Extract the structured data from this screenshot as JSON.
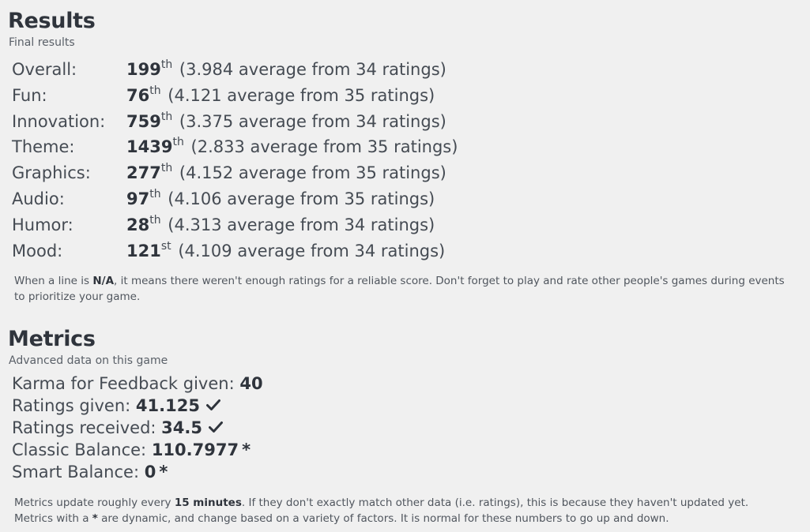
{
  "results": {
    "title": "Results",
    "subtitle": "Final results",
    "rows": [
      {
        "label": "Overall:",
        "rank": "199",
        "suffix": "th",
        "detail": "(3.984 average from 34 ratings)"
      },
      {
        "label": "Fun:",
        "rank": "76",
        "suffix": "th",
        "detail": "(4.121 average from 35 ratings)"
      },
      {
        "label": "Innovation:",
        "rank": "759",
        "suffix": "th",
        "detail": "(3.375 average from 34 ratings)"
      },
      {
        "label": "Theme:",
        "rank": "1439",
        "suffix": "th",
        "detail": "(2.833 average from 35 ratings)"
      },
      {
        "label": "Graphics:",
        "rank": "277",
        "suffix": "th",
        "detail": "(4.152 average from 35 ratings)"
      },
      {
        "label": "Audio:",
        "rank": "97",
        "suffix": "th",
        "detail": "(4.106 average from 35 ratings)"
      },
      {
        "label": "Humor:",
        "rank": "28",
        "suffix": "th",
        "detail": "(4.313 average from 34 ratings)"
      },
      {
        "label": "Mood:",
        "rank": "121",
        "suffix": "st",
        "detail": "(4.109 average from 34 ratings)"
      }
    ],
    "note": {
      "before": "When a line is ",
      "emphasis": "N/A",
      "after": ", it means there weren't enough ratings for a reliable score. Don't forget to play and rate other people's games during events to prioritize your game."
    }
  },
  "metrics": {
    "title": "Metrics",
    "subtitle": "Advanced data on this game",
    "rows": [
      {
        "label": "Karma for Feedback given: ",
        "value": "40",
        "mark": ""
      },
      {
        "label": "Ratings given: ",
        "value": "41.125",
        "mark": "check"
      },
      {
        "label": "Ratings received: ",
        "value": "34.5",
        "mark": "check"
      },
      {
        "label": "Classic Balance: ",
        "value": "110.7977",
        "mark": "*"
      },
      {
        "label": "Smart Balance: ",
        "value": "0",
        "mark": "*"
      }
    ],
    "note": {
      "before": "Metrics update roughly every ",
      "emphasis": "15 minutes",
      "middle": ". If they don't exactly match other data (i.e. ratings), this is because they haven't updated yet. Metrics with a ",
      "emphasis2": "*",
      "after": " are dynamic, and change based on a variety of factors. It is normal for these numbers to go up and down."
    }
  }
}
